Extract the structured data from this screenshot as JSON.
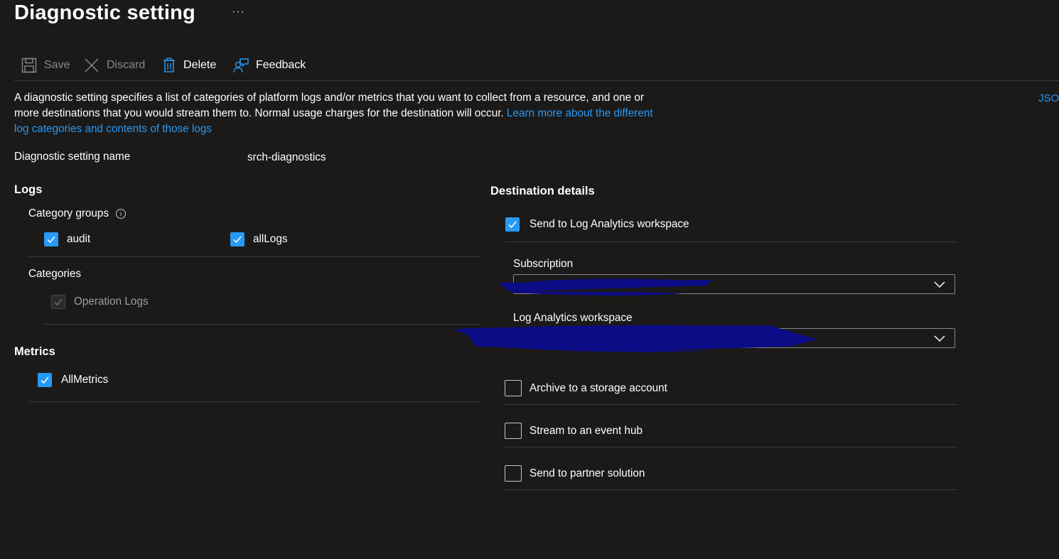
{
  "page": {
    "title": "Diagnostic setting",
    "more_label": "···"
  },
  "toolbar": {
    "save_label": "Save",
    "discard_label": "Discard",
    "delete_label": "Delete",
    "feedback_label": "Feedback"
  },
  "description": {
    "text": "A diagnostic setting specifies a list of categories of platform logs and/or metrics that you want to collect from a resource, and one or more destinations that you would stream them to. Normal usage charges for the destination will occur. ",
    "link_text": "Learn more about the different log categories and contents of those logs",
    "json_link": "JSO"
  },
  "setting_name": {
    "label": "Diagnostic setting name",
    "value": "srch-diagnostics"
  },
  "logs": {
    "title": "Logs",
    "category_groups_label": "Category groups",
    "groups": [
      {
        "label": "audit",
        "checked": true
      },
      {
        "label": "allLogs",
        "checked": true
      }
    ],
    "categories_label": "Categories",
    "categories": [
      {
        "label": "Operation Logs",
        "checked": true,
        "disabled": true
      }
    ]
  },
  "metrics": {
    "title": "Metrics",
    "items": [
      {
        "label": "AllMetrics",
        "checked": true
      }
    ]
  },
  "destination": {
    "title": "Destination details",
    "log_analytics": {
      "label": "Send to Log Analytics workspace",
      "checked": true
    },
    "subscription_label": "Subscription",
    "workspace_label": "Log Analytics workspace",
    "storage": {
      "label": "Archive to a storage account",
      "checked": false
    },
    "event_hub": {
      "label": "Stream to an event hub",
      "checked": false
    },
    "partner": {
      "label": "Send to partner solution",
      "checked": false
    }
  },
  "colors": {
    "background": "#1b1a19",
    "accent": "#2899f5",
    "divider": "#3b3a39",
    "redaction": "#0b0b86"
  }
}
